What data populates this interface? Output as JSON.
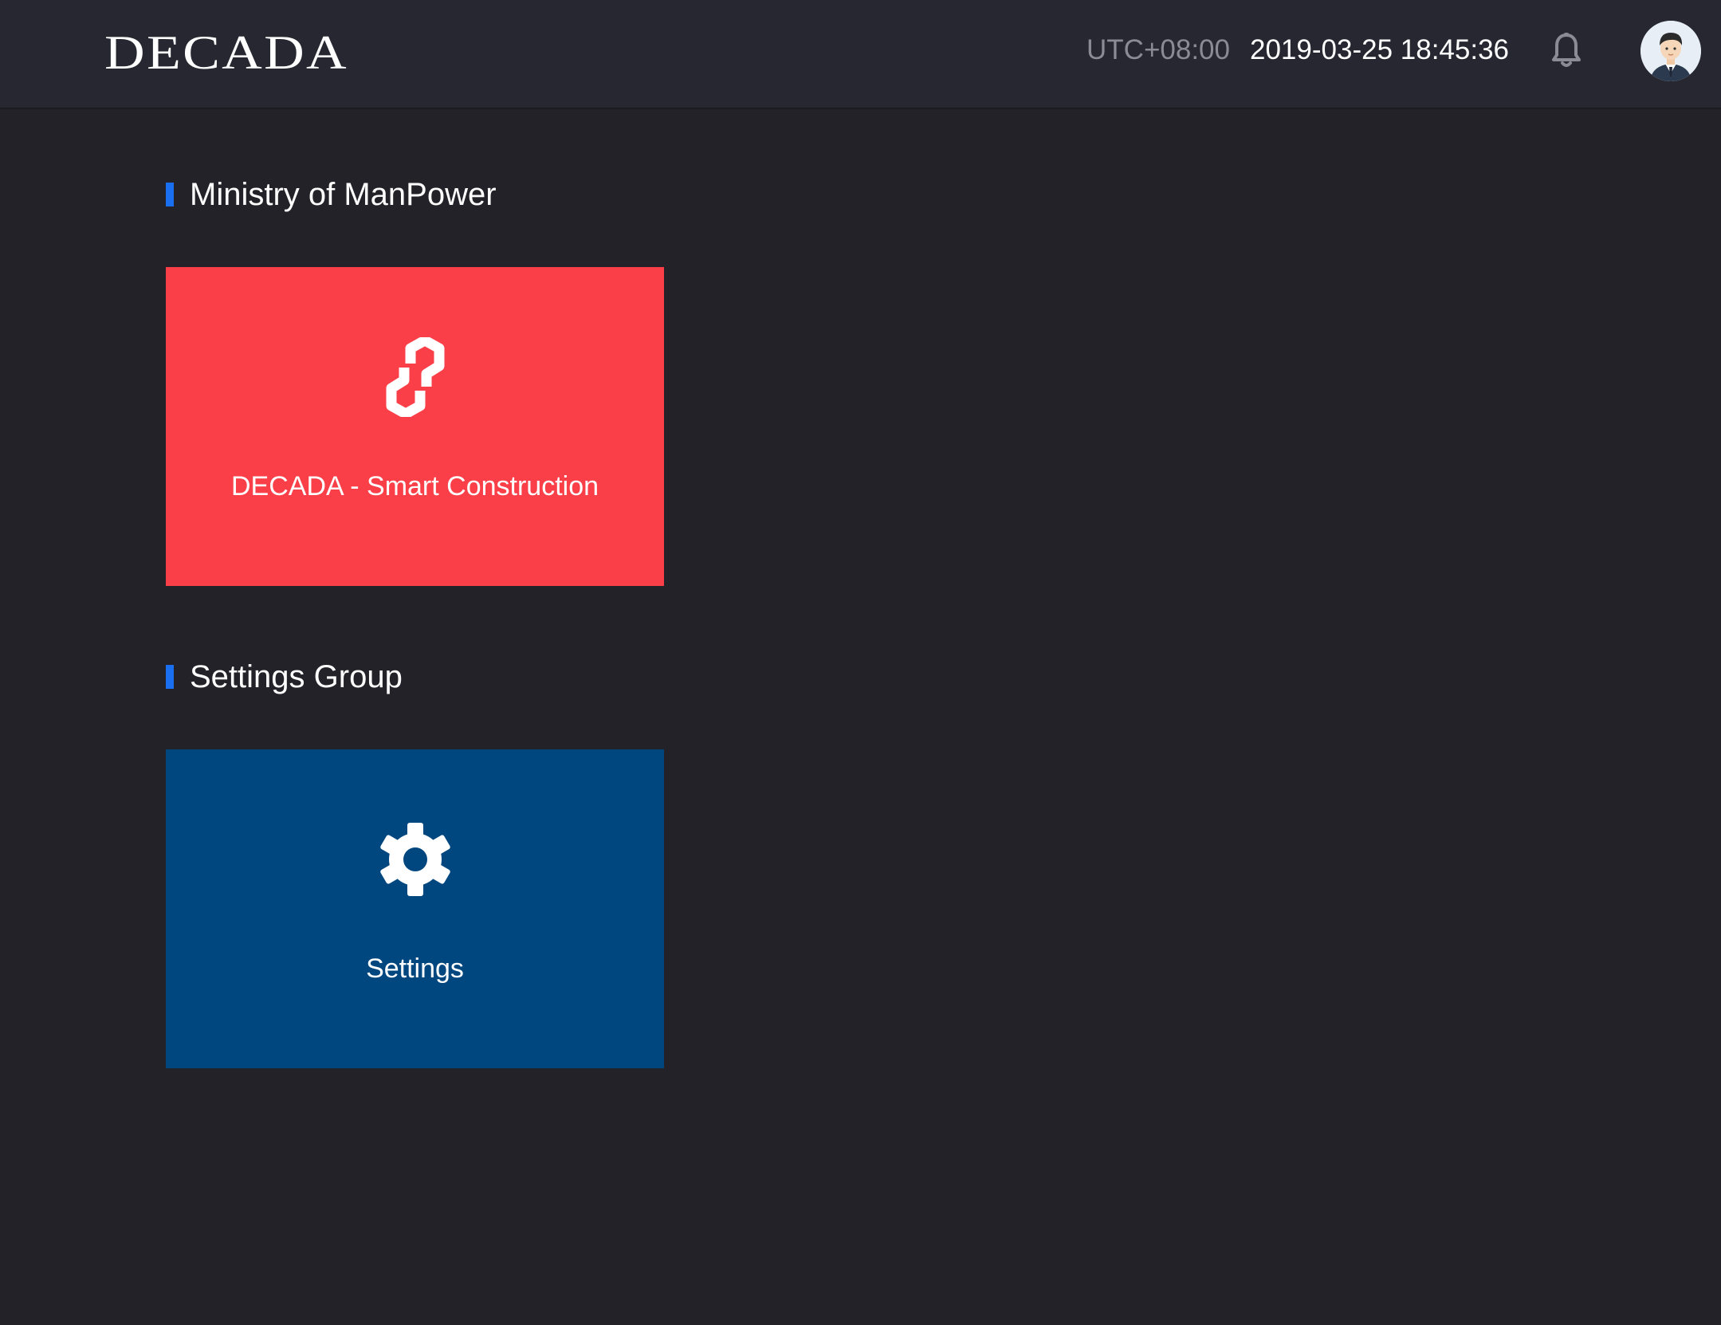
{
  "header": {
    "logo_text": "DECADA",
    "timezone": "UTC+08:00",
    "datetime": "2019-03-25 18:45:36",
    "notification_icon": "bell-icon",
    "avatar_icon": "user-avatar"
  },
  "sections": [
    {
      "title": "Ministry of ManPower",
      "accent": "#1a6ef0",
      "apps": [
        {
          "label": "DECADA - Smart Construction",
          "icon": "hexagon-link-icon",
          "color": "#fa3f48"
        }
      ]
    },
    {
      "title": "Settings Group",
      "accent": "#1a6ef0",
      "apps": [
        {
          "label": "Settings",
          "icon": "gear-icon",
          "color": "#00467f"
        }
      ]
    }
  ],
  "colors": {
    "background": "#222228",
    "topbar": "#262730",
    "timezone_text": "#8a8b94"
  }
}
